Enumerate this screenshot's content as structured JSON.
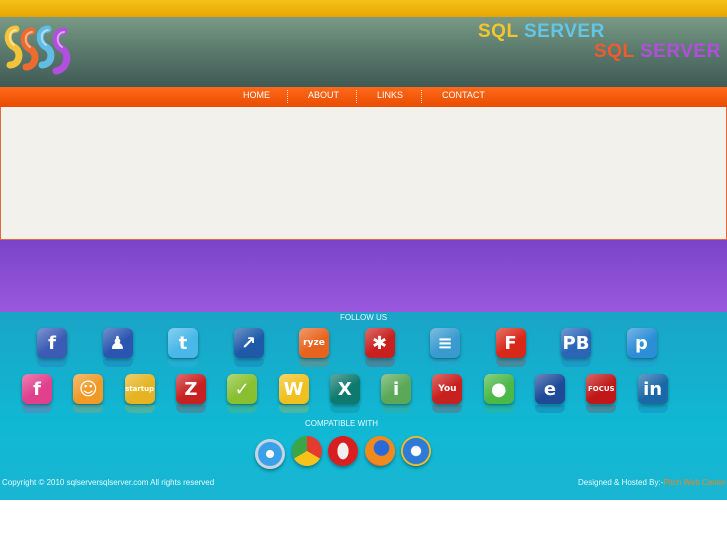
{
  "brand": {
    "line1": {
      "word1": "SQL",
      "word2": "SERVER"
    },
    "line2": {
      "word1": "SQL",
      "word2": "SERVER"
    }
  },
  "nav": {
    "items": [
      {
        "label": "HOME"
      },
      {
        "label": "ABOUT"
      },
      {
        "label": "LINKS"
      },
      {
        "label": "CONTACT"
      }
    ]
  },
  "footer": {
    "follow_title": "FOLLOW US",
    "compatible_title": "COMPATIBLE WITH",
    "copyright": "Copyright © 2010 sqlserversqlserver.com All rights reserved",
    "designed_prefix": "Designed & Hosted By:-",
    "designer": "Pitch Web Center"
  },
  "social_row1": [
    {
      "icon": "facebook-icon",
      "glyph": "f",
      "color": "#3b5bb5"
    },
    {
      "icon": "myspace-icon",
      "glyph": "♟",
      "color": "#2a55b0"
    },
    {
      "icon": "twitter-icon",
      "glyph": "t",
      "color": "#49b8e8"
    },
    {
      "icon": "stumble-chart-icon",
      "glyph": "↗",
      "color": "#1f5aa8"
    },
    {
      "icon": "ryze-icon",
      "glyph": "ryze",
      "color": "#e8641e"
    },
    {
      "icon": "yelp-icon",
      "glyph": "✱",
      "color": "#c8201e"
    },
    {
      "icon": "friendfeed-icon",
      "glyph": "≡",
      "color": "#3a9ad0"
    },
    {
      "icon": "fark-icon",
      "glyph": "F",
      "color": "#d8281a"
    },
    {
      "icon": "plaxo-icon",
      "glyph": "PB",
      "color": "#2a65b8"
    },
    {
      "icon": "pownce-icon",
      "glyph": "p",
      "color": "#2d8ed8"
    }
  ],
  "social_row2": [
    {
      "icon": "facebook-pink-icon",
      "glyph": "f",
      "color": "#e0408c"
    },
    {
      "icon": "friend-icon",
      "glyph": "☺",
      "color": "#f09a28"
    },
    {
      "icon": "startup-icon",
      "glyph": "startup",
      "color": "#e6b422"
    },
    {
      "icon": "zoho-icon",
      "glyph": "Z",
      "color": "#c82020"
    },
    {
      "icon": "zerply-icon",
      "glyph": "✓",
      "color": "#88c030"
    },
    {
      "icon": "wakoopa-icon",
      "glyph": "W",
      "color": "#f0c020"
    },
    {
      "icon": "xing-icon",
      "glyph": "X",
      "color": "#0e7a6e"
    },
    {
      "icon": "ilike-icon",
      "glyph": "i",
      "color": "#5aa858"
    },
    {
      "icon": "youtube-icon",
      "glyph": "You",
      "color": "#c8201e"
    },
    {
      "icon": "technorati-icon",
      "glyph": "●",
      "color": "#4cb848"
    },
    {
      "icon": "e-icon",
      "glyph": "e",
      "color": "#1e4a98"
    },
    {
      "icon": "focus-icon",
      "glyph": "FOCUS",
      "color": "#c01818"
    },
    {
      "icon": "linkedin-icon",
      "glyph": "in",
      "color": "#1a68a8"
    }
  ],
  "browsers": [
    {
      "icon": "safari-icon"
    },
    {
      "icon": "chrome-icon"
    },
    {
      "icon": "opera-icon"
    },
    {
      "icon": "firefox-icon"
    },
    {
      "icon": "internet-explorer-icon"
    }
  ]
}
